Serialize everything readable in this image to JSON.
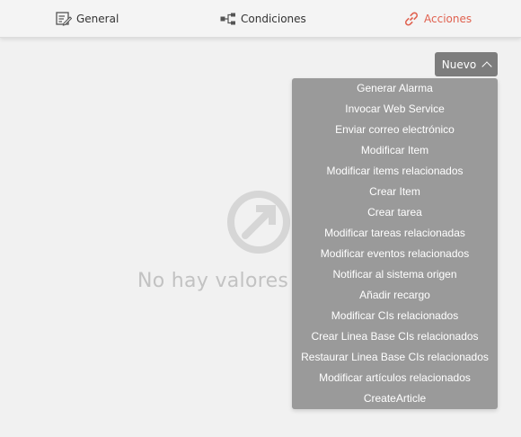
{
  "tabs": [
    {
      "label": "General",
      "icon": "edit-document-icon",
      "active": false
    },
    {
      "label": "Condiciones",
      "icon": "flow-nodes-icon",
      "active": false
    },
    {
      "label": "Acciones",
      "icon": "link-icon",
      "active": true
    }
  ],
  "accent_color": "#e0614f",
  "empty_state": {
    "icon": "external-link-icon",
    "text": "No hay valores a"
  },
  "nuevo_button": {
    "label": "Nuevo",
    "icon": "chevron-up-icon"
  },
  "dropdown_items": [
    "Generar Alarma",
    "Invocar Web Service",
    "Enviar correo electrónico",
    "Modificar Item",
    "Modificar items relacionados",
    "Crear Item",
    "Crear tarea",
    "Modificar tareas relacionadas",
    "Modificar eventos relacionados",
    "Notificar al sistema origen",
    "Añadir recargo",
    "Modificar CIs relacionados",
    "Crear Linea Base CIs relacionados",
    "Restaurar Linea Base CIs relacionados",
    "Modificar artículos relacionados",
    "CreateArticle"
  ]
}
